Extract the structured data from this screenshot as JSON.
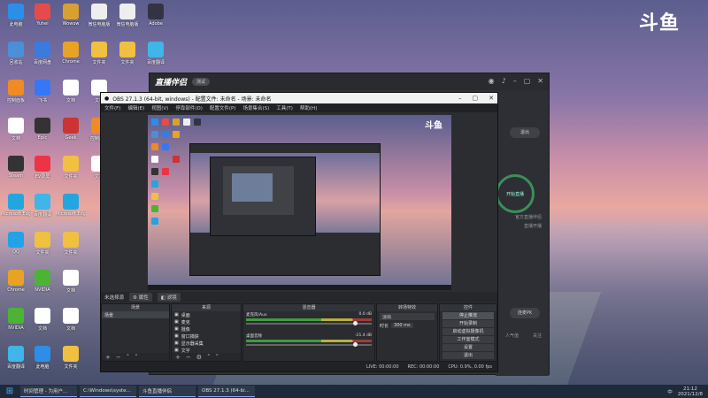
{
  "desktop": {
    "brand": "斗鱼",
    "icons": [
      {
        "label": "此电脑",
        "color": "#2c8ee8"
      },
      {
        "label": "Yuhei",
        "color": "#e64b4b"
      },
      {
        "label": "Wowow",
        "color": "#d8a030"
      },
      {
        "label": "微信电脑版",
        "color": "#eee"
      },
      {
        "label": "Adobe",
        "color": "#334"
      },
      {
        "label": "回收站",
        "color": "#4a8fd8"
      },
      {
        "label": "百度网盘",
        "color": "#3a7be0"
      },
      {
        "label": "Chrome",
        "color": "#e8a325"
      },
      {
        "label": "文件夹",
        "color": "#f0c040"
      },
      {
        "label": "百度翻译",
        "color": "#3fb5e8"
      },
      {
        "label": "控制面板",
        "color": "#f08a24"
      },
      {
        "label": "飞书",
        "color": "#3777f5"
      },
      {
        "label": "文档",
        "color": "#fff"
      },
      {
        "label": "Steam",
        "color": "#333"
      },
      {
        "label": "EV录屏",
        "color": "#e34"
      },
      {
        "label": "Epic",
        "color": "#222"
      },
      {
        "label": "Geek",
        "color": "#c33"
      },
      {
        "label": "Microsoft Edge",
        "color": "#23a6e0"
      },
      {
        "label": "NVIDIA",
        "color": "#4cb335"
      },
      {
        "label": "QQ",
        "color": "#23a2e8"
      }
    ]
  },
  "helper": {
    "logo": "直播伴侣",
    "badge": "测试",
    "exit_label": "退出",
    "start_label": "开始直播",
    "side_text_1": "官方直播伴侣",
    "side_text_2": "直播开播",
    "lower_btn": "连麦PK",
    "stat_1": "人气值",
    "stat_2": "关注"
  },
  "obs": {
    "title": "OBS 27.1.3 (64-bit, windows) - 配置文件: 未命名 - 场景: 未命名",
    "menu": [
      "文件(F)",
      "编辑(E)",
      "视图(V)",
      "停靠部件(D)",
      "配置文件(P)",
      "场景集合(S)",
      "工具(T)",
      "帮助(H)"
    ],
    "preview_brand": "斗鱼",
    "scene_strip": {
      "label": "未选择源",
      "props": "属性",
      "filters": "滤镜"
    },
    "docks": {
      "scenes": {
        "header": "场景",
        "items": [
          "场景"
        ]
      },
      "sources": {
        "header": "来源",
        "items": [
          "桌面",
          "麦克",
          "摄像",
          "窗口捕获",
          "显示器采集",
          "文字"
        ]
      },
      "mixer": {
        "header": "混音器",
        "rows": [
          {
            "name": "麦克风/Aux",
            "db": "0.0 dB"
          },
          {
            "name": "桌面音频",
            "db": "-21.4 dB"
          }
        ]
      },
      "transitions": {
        "header": "转场特效",
        "value": "淡出",
        "duration_label": "时长",
        "duration": "300 ms"
      },
      "controls": {
        "header": "控件",
        "buttons": [
          "停止推流",
          "开始录制",
          "启动虚拟摄像机",
          "工作室模式",
          "设置",
          "退出"
        ]
      }
    },
    "status": {
      "live": "LIVE: 00:00:00",
      "rec": "REC: 00:00:00",
      "cpu": "CPU: 0.9%, 0.00 fps"
    }
  },
  "taskbar": {
    "items": [
      "时间管理 - 为用户...",
      "C:\\Windows\\syste...",
      "斗鱼直播伴侣",
      "OBS 27.1.3 (64-bi..."
    ],
    "tray": [
      "中"
    ],
    "time": "21:12",
    "date": "2021/12/8"
  }
}
